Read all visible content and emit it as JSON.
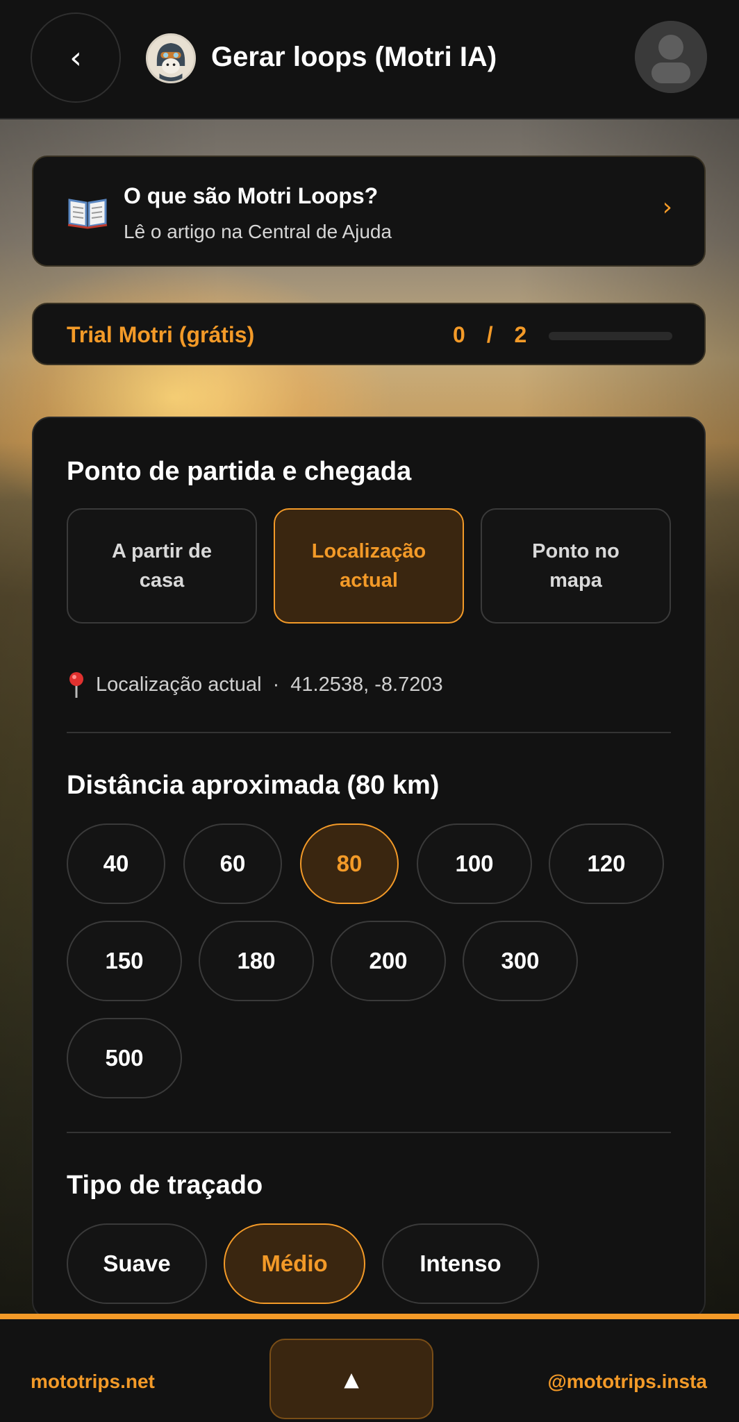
{
  "header": {
    "back_icon": "chevron-left",
    "title": "Gerar loops (Motri IA)",
    "logo_icon": "motri-rider-avatar",
    "profile_icon": "user-avatar"
  },
  "help": {
    "icon": "open-book",
    "title": "O que são Motri Loops?",
    "subtitle": "Lê o artigo na Central de Ajuda",
    "chevron": "›"
  },
  "trial": {
    "label": "Trial Motri (grátis)",
    "used": "0",
    "separator": "/",
    "total": "2",
    "progress_fraction": 0
  },
  "start_point": {
    "title": "Ponto de partida e chegada",
    "options": [
      {
        "line1": "A partir de",
        "line2": "casa",
        "selected": false
      },
      {
        "line1": "Localização",
        "line2": "actual",
        "selected": true
      },
      {
        "line1": "Ponto no",
        "line2": "mapa",
        "selected": false
      }
    ],
    "location_label": "Localização actual",
    "location_dot": "·",
    "coordinates": "41.2538, -8.7203"
  },
  "distance": {
    "title": "Distância aproximada (80 km)",
    "options": [
      "40",
      "60",
      "80",
      "100",
      "120",
      "150",
      "180",
      "200",
      "300",
      "500"
    ],
    "selected": "80"
  },
  "route_type": {
    "title": "Tipo de traçado",
    "options": [
      "Suave",
      "Médio",
      "Intenso"
    ],
    "selected": "Médio"
  },
  "footer": {
    "left_link": "mototrips.net",
    "center_button": "▲",
    "right_link": "@mototrips.insta"
  },
  "colors": {
    "accent": "#f39a28",
    "background": "#121212",
    "selected_fill": "#3a2610"
  }
}
